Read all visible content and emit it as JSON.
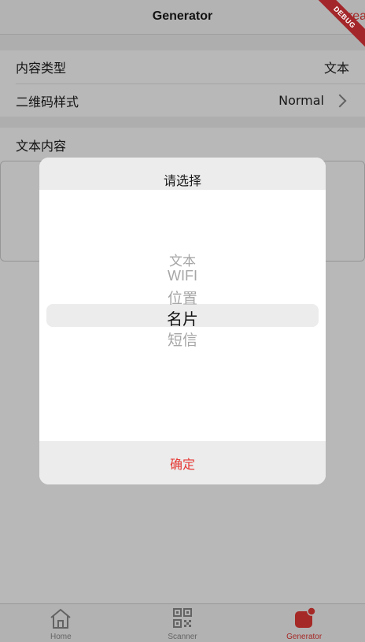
{
  "nav": {
    "title": "Generator",
    "action": "Crea"
  },
  "form": {
    "content_type_label": "内容类型",
    "content_type_value": "文本",
    "qr_style_label": "二维码样式",
    "qr_style_value": "Normal",
    "text_content_label": "文本内容"
  },
  "dialog": {
    "title": "请选择",
    "options": [
      "文本",
      "WIFI",
      "位置",
      "名片",
      "短信"
    ],
    "selected": "名片",
    "confirm": "确定"
  },
  "tabbar": {
    "items": [
      {
        "label": "Home",
        "icon": "home-icon"
      },
      {
        "label": "Scanner",
        "icon": "qr-icon"
      },
      {
        "label": "Generator",
        "icon": "generator-icon"
      }
    ],
    "active": "Generator"
  },
  "debug": {
    "label": "DEBUG"
  },
  "colors": {
    "accent": "#e53935",
    "ribbon": "#a3262a"
  }
}
